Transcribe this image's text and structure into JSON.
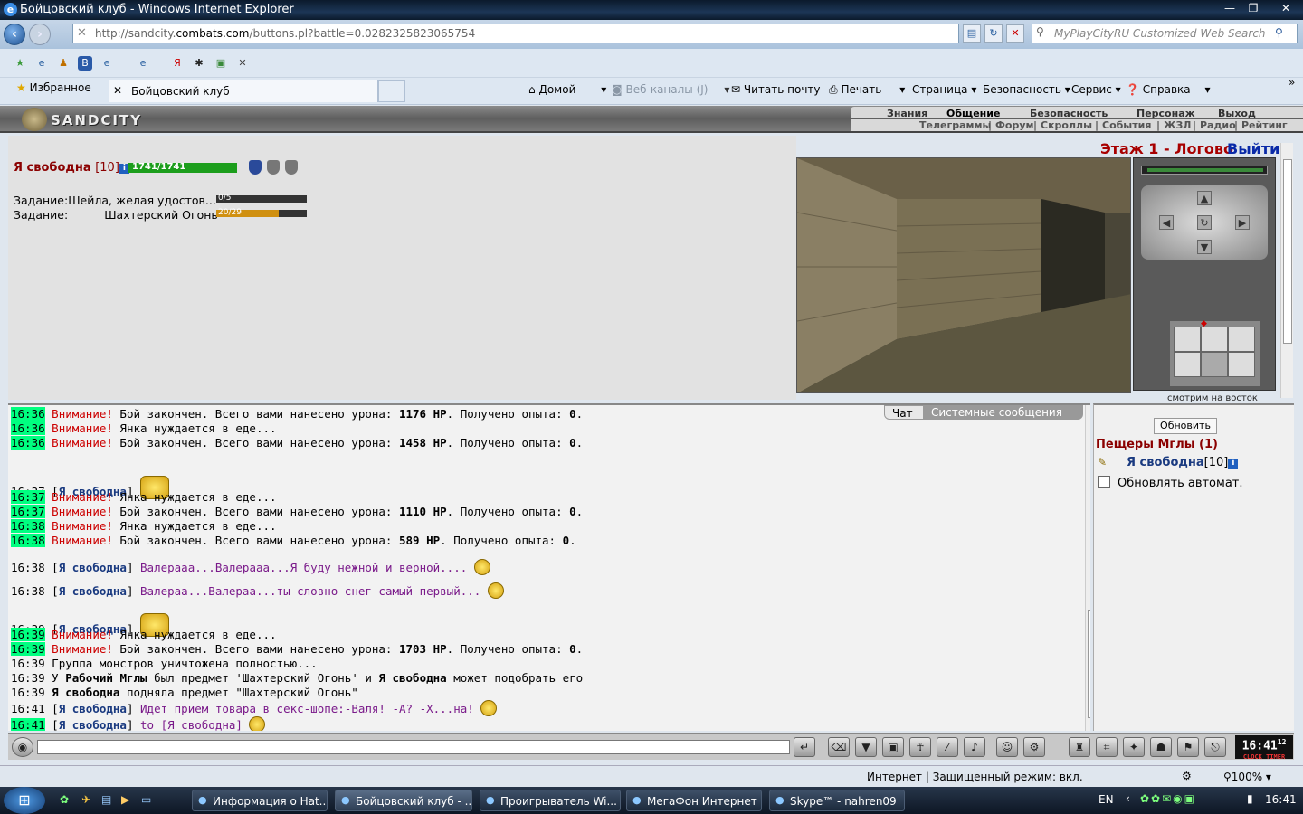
{
  "window": {
    "title": "Бойцовский клуб - Windows Internet Explorer",
    "min": "—",
    "max": "❐",
    "close": "✕"
  },
  "address": {
    "url_pre": "http://sandcity.",
    "url_bold": "combats.com",
    "url_post": "/buttons.pl?battle=0.0282325823065754"
  },
  "search": {
    "placeholder": "MyPlayCityRU Customized Web Search"
  },
  "favorites": {
    "label": "Избранное"
  },
  "tab": {
    "label": "Бойцовский клуб"
  },
  "commands": [
    "Домой",
    "Веб-каналы (J)",
    "Читать почту",
    "Печать",
    "Страница",
    "Безопасность",
    "Сервис",
    "Справка"
  ],
  "game": {
    "logo": "SANDCITY",
    "menu_top": [
      "Знания",
      "Общение",
      "Безопасность",
      "Персонаж",
      "Выход"
    ],
    "menu_bottom": [
      "Телеграммы",
      "|",
      "Форум",
      "|",
      "Скроллы",
      "|",
      "События",
      "|",
      "ЖЗЛ",
      "|",
      "Радио",
      "|",
      "Рейтинг"
    ],
    "player": {
      "name": "Я свободна",
      "level": "[10]",
      "hp": "1741/1741",
      "hp_fraction": 1.0
    },
    "tasks": [
      {
        "label": "Задание:",
        "text": "Шейла, желая удостов...",
        "progress": "0/5",
        "fraction": 0.0,
        "color": "#333333"
      },
      {
        "label": "Задание:",
        "text": "Шахтерский Огонь",
        "progress": "20/29",
        "fraction": 0.69,
        "color": "#d09010"
      }
    ],
    "floor": "Этаж 1 - Логово",
    "exit": "Выйти",
    "look": "смотрим на восток"
  },
  "chat": {
    "tabs": [
      "Чат",
      "Системные сообщения"
    ],
    "lines": [
      {
        "time": "16:36",
        "hl": true,
        "warn": "Внимание!",
        "text": " Бой закончен. Всего вами нанесено урона: ",
        "bold": "1176 HP",
        "text2": ". Получено опыта: ",
        "bold2": "0",
        "text3": "."
      },
      {
        "time": "16:36",
        "hl": true,
        "warn": "Внимание!",
        "text": " Янка нуждается в еде...",
        "bold": "",
        "text2": "",
        "bold2": "",
        "text3": ""
      },
      {
        "time": "16:36",
        "hl": true,
        "warn": "Внимание!",
        "text": " Бой закончен. Всего вами нанесено урона: ",
        "bold": "1458 HP",
        "text2": ". Получено опыта: ",
        "bold2": "0",
        "text3": "."
      },
      {
        "time": "16:37",
        "hl": false,
        "who": "Я свободна",
        "msg": ""
      },
      {
        "time": "16:37",
        "hl": true,
        "warn": "Внимание!",
        "text": " Янка нуждается в еде...",
        "bold": "",
        "text2": "",
        "bold2": "",
        "text3": ""
      },
      {
        "time": "16:37",
        "hl": true,
        "warn": "Внимание!",
        "text": " Бой закончен. Всего вами нанесено урона: ",
        "bold": "1110 HP",
        "text2": ". Получено опыта: ",
        "bold2": "0",
        "text3": "."
      },
      {
        "time": "16:38",
        "hl": true,
        "warn": "Внимание!",
        "text": " Янка нуждается в еде...",
        "bold": "",
        "text2": "",
        "bold2": "",
        "text3": ""
      },
      {
        "time": "16:38",
        "hl": true,
        "warn": "Внимание!",
        "text": " Бой закончен. Всего вами нанесено урона: ",
        "bold": "589 HP",
        "text2": ". Получено опыта: ",
        "bold2": "0",
        "text3": "."
      },
      {
        "time": "16:38",
        "hl": false,
        "who": "Я свободна",
        "msg": "Валерааа...Валерааа...Я буду нежной и верной...."
      },
      {
        "time": "16:38",
        "hl": false,
        "who": "Я свободна",
        "msg": "Валераа...Валераа...ты словно снег самый первый..."
      },
      {
        "time": "16:39",
        "hl": false,
        "who": "Я свободна",
        "msg": ""
      },
      {
        "time": "16:39",
        "hl": true,
        "warn": "Внимание!",
        "text": " Янка нуждается в еде...",
        "bold": "",
        "text2": "",
        "bold2": "",
        "text3": ""
      },
      {
        "time": "16:39",
        "hl": true,
        "warn": "Внимание!",
        "text": " Бой закончен. Всего вами нанесено урона: ",
        "bold": "1703 HP",
        "text2": ". Получено опыта: ",
        "bold2": "0",
        "text3": "."
      },
      {
        "time": "16:39",
        "hl": false,
        "plain": "Группа монстров уничтожена полностью..."
      },
      {
        "time": "16:39",
        "hl": false,
        "plainrich": [
          "У ",
          "Рабочий Мглы",
          " был предмет 'Шахтерский Огонь' и ",
          "Я свободна",
          " может подобрать его"
        ]
      },
      {
        "time": "16:39",
        "hl": false,
        "plainrich": [
          "",
          "Я свободна",
          " подняла предмет \"Шахтерский Огонь\"",
          "",
          ""
        ]
      },
      {
        "time": "16:41",
        "hl": false,
        "who": "Я свободна",
        "msg": "Идет прием товара в секс-шопе:-Валя! -А? -Х...на!"
      },
      {
        "time": "16:41",
        "hl": true,
        "who": "Я свободна",
        "msg": "to [Я свободна]"
      }
    ]
  },
  "online": {
    "refresh": "Обновить",
    "room": "Пещеры Мглы (1)",
    "user": "Я свободна",
    "level": "[10]",
    "auto": "Обновлять автомат."
  },
  "clock": {
    "time": "16:41",
    "sec": "12",
    "labels": "CLOCK TIMER"
  },
  "status": {
    "text": "Интернет | Защищенный режим: вкл.",
    "zoom": "100%"
  },
  "taskbar": {
    "items": [
      "Информация о Hat...",
      "Бойцовский клуб - ...",
      "Проигрыватель Wi...",
      "МегаФон Интернет",
      "Skype™ - nahren09"
    ],
    "lang": "EN",
    "time": "16:41"
  }
}
